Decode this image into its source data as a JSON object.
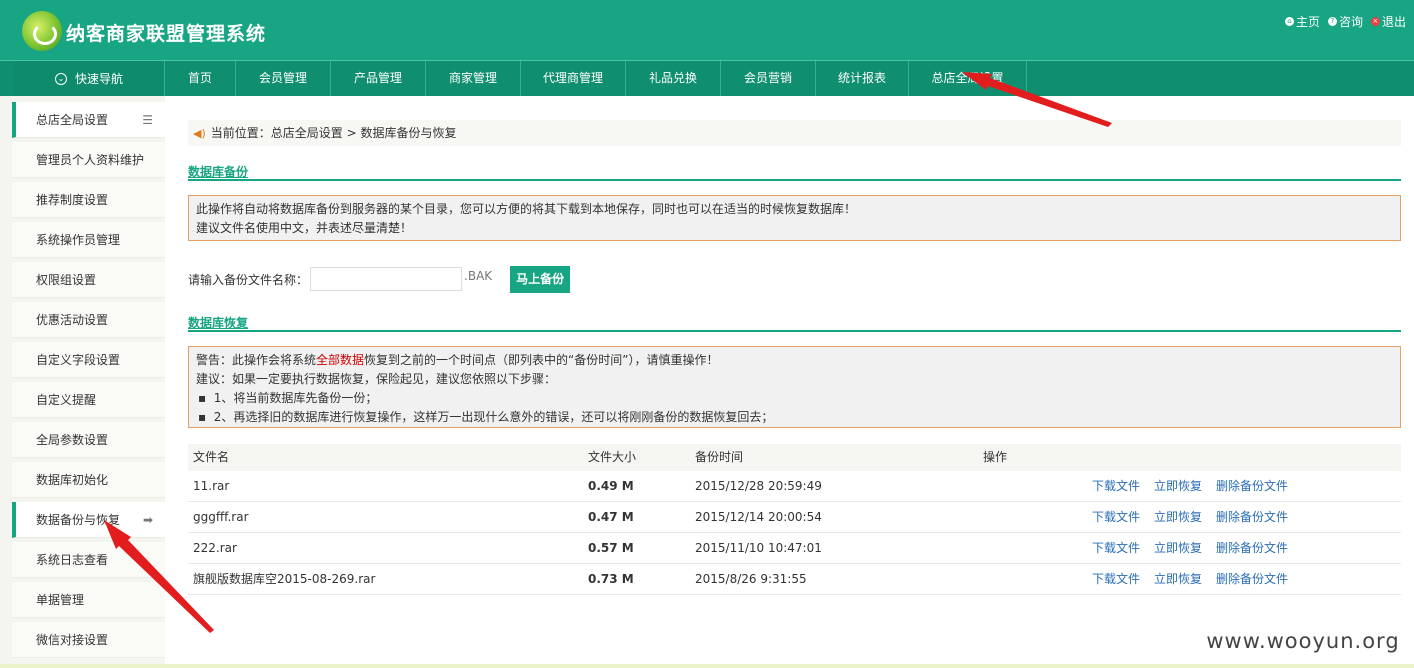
{
  "header": {
    "title": "纳客商家联盟管理系统",
    "links": [
      "主页",
      "咨询",
      "退出"
    ]
  },
  "nav": {
    "quick": "快速导航",
    "items": [
      "首页",
      "会员管理",
      "产品管理",
      "商家管理",
      "代理商管理",
      "礼品兑换",
      "会员营销",
      "统计报表",
      "总店全局设置"
    ]
  },
  "sidebar": {
    "items": [
      "总店全局设置",
      "管理员个人资料维护",
      "推荐制度设置",
      "系统操作员管理",
      "权限组设置",
      "优惠活动设置",
      "自定义字段设置",
      "自定义提醒",
      "全局参数设置",
      "数据库初始化",
      "数据备份与恢复",
      "系统日志查看",
      "单据管理",
      "微信对接设置"
    ]
  },
  "breadcrumb": "当前位置：总店全局设置 > 数据库备份与恢复",
  "backup": {
    "title": "数据库备份",
    "notice1": "此操作将自动将数据库备份到服务器的某个目录，您可以方便的将其下载到本地保存，同时也可以在适当的时候恢复数据库！",
    "notice2": "建议文件名使用中文，并表述尽量清楚！",
    "input_label": "请输入备份文件名称：",
    "suffix": ".BAK",
    "button": "马上备份"
  },
  "restore": {
    "title": "数据库恢复",
    "warn_pre": "警告：此操作会将系统",
    "warn_red": "全部数据",
    "warn_post": "恢复到之前的一个时间点（即列表中的“备份时间”），请慎重操作！",
    "advice": "建议：如果一定要执行数据恢复，保险起见，建议您依照以下步骤：",
    "step1": "1、将当前数据库先备份一份；",
    "step2": "2、再选择旧的数据库进行恢复操作，这样万一出现什么意外的错误，还可以将刚刚备份的数据恢复回去；"
  },
  "table": {
    "headers": [
      "文件名",
      "文件大小",
      "备份时间",
      "操作"
    ],
    "rows": [
      {
        "name": "11.rar",
        "size": "0.49 M",
        "time": "2015/12/28 20:59:49"
      },
      {
        "name": "gggfff.rar",
        "size": "0.47 M",
        "time": "2015/12/14 20:00:54"
      },
      {
        "name": "222.rar",
        "size": "0.57 M",
        "time": "2015/11/10 10:47:01"
      },
      {
        "name": "旗舰版数据库空2015-08-269.rar",
        "size": "0.73 M",
        "time": "2015/8/26 9:31:55"
      }
    ],
    "actions": [
      "下载文件",
      "立即恢复",
      "删除备份文件"
    ]
  },
  "watermark": "www.wooyun.org"
}
